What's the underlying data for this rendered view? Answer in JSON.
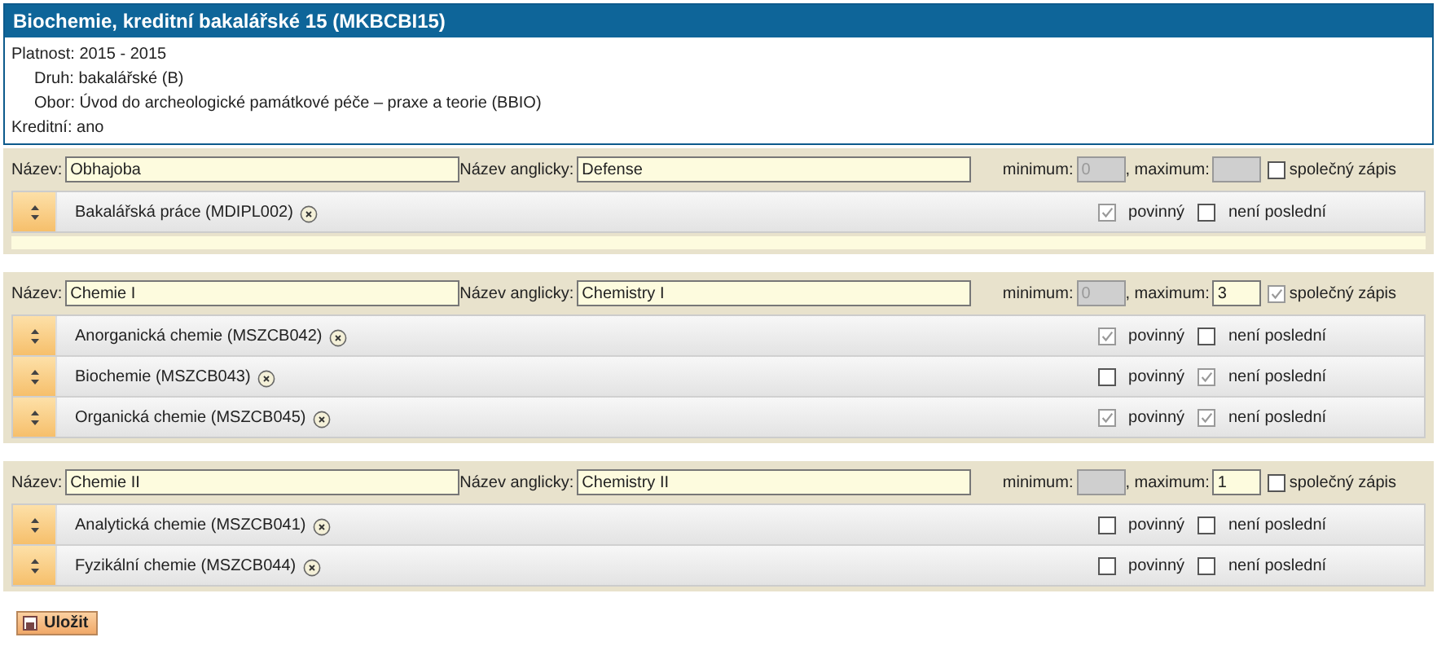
{
  "header": {
    "title": "Biochemie, kreditní bakalářské 15 (MKBCBI15)",
    "lines": [
      {
        "label": "Platnost:",
        "value": "2015 - 2015",
        "indent": false
      },
      {
        "label": "Druh:",
        "value": "bakalářské (B)",
        "indent": true
      },
      {
        "label": "Obor:",
        "value": "Úvod do archeologické památkové péče – praxe a teorie (BBIO)",
        "indent": true
      },
      {
        "label": "Kreditní:",
        "value": "ano",
        "indent": false
      }
    ]
  },
  "blocks": [
    {
      "name_label": "Název:",
      "name": "Obhajoba",
      "english_label": "Název anglicky:",
      "english": "Defense",
      "min_label": "minimum:",
      "min": {
        "value": "0",
        "disabled": true
      },
      "max_label": ", maximum:",
      "max": {
        "disabled": true
      },
      "joint_label": "společný zápis",
      "joint": false,
      "empty_slot": true,
      "courses": [
        {
          "name": "Bakalářská práce (MDIPL002)",
          "mandatory_label": "povinný",
          "mandatory": true,
          "not_last_label": "není poslední",
          "not_last": false
        }
      ]
    },
    {
      "name_label": "Název:",
      "name": "Chemie I",
      "english_label": "Název anglicky:",
      "english": "Chemistry I",
      "min_label": "minimum:",
      "min": {
        "value": "0",
        "disabled": true
      },
      "max_label": ", maximum:",
      "max": {
        "value": "3",
        "disabled": false
      },
      "joint_label": "společný zápis",
      "joint": true,
      "empty_slot": false,
      "courses": [
        {
          "name": "Anorganická chemie (MSZCB042)",
          "mandatory_label": "povinný",
          "mandatory": true,
          "not_last_label": "není poslední",
          "not_last": false
        },
        {
          "name": "Biochemie (MSZCB043)",
          "mandatory_label": "povinný",
          "mandatory": false,
          "not_last_label": "není poslední",
          "not_last": true
        },
        {
          "name": "Organická chemie (MSZCB045)",
          "mandatory_label": "povinný",
          "mandatory": true,
          "not_last_label": "není poslední",
          "not_last": true
        }
      ]
    },
    {
      "name_label": "Název:",
      "name": "Chemie II",
      "english_label": "Název anglicky:",
      "english": "Chemistry II",
      "min_label": "minimum:",
      "min": {
        "disabled": true
      },
      "max_label": ", maximum:",
      "max": {
        "value": "1",
        "disabled": false
      },
      "joint_label": "společný zápis",
      "joint": false,
      "empty_slot": false,
      "courses": [
        {
          "name": "Analytická chemie (MSZCB041)",
          "mandatory_label": "povinný",
          "mandatory": false,
          "not_last_label": "není poslední",
          "not_last": false
        },
        {
          "name": "Fyzikální chemie (MSZCB044)",
          "mandatory_label": "povinný",
          "mandatory": false,
          "not_last_label": "není poslední",
          "not_last": false
        }
      ]
    }
  ],
  "save_button": "Uložit"
}
